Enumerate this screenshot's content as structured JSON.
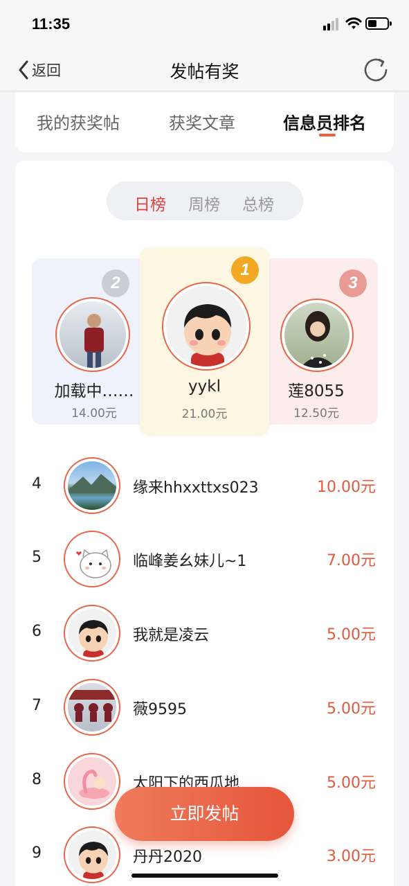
{
  "status_bar": {
    "time": "11:35"
  },
  "nav": {
    "back_label": "返回",
    "title": "发帖有奖"
  },
  "tabs": [
    {
      "label": "我的获奖帖",
      "active": false
    },
    {
      "label": "获奖文章",
      "active": false
    },
    {
      "label": "信息员排名",
      "active": true
    }
  ],
  "period_tabs": [
    {
      "label": "日榜",
      "active": true
    },
    {
      "label": "周榜",
      "active": false
    },
    {
      "label": "总榜",
      "active": false
    }
  ],
  "podium": {
    "first": {
      "rank": "1",
      "name": "yykl",
      "amount": "21.00元"
    },
    "second": {
      "rank": "2",
      "name": "加载中……",
      "amount": "14.00元"
    },
    "third": {
      "rank": "3",
      "name": "莲8055",
      "amount": "12.50元"
    }
  },
  "ranking_list": [
    {
      "rank": "4",
      "name": "缘来hhxxttxs023",
      "amount": "10.00元"
    },
    {
      "rank": "5",
      "name": "临峰姜幺妹儿~1",
      "amount": "7.00元"
    },
    {
      "rank": "6",
      "name": "我就是凌云",
      "amount": "5.00元"
    },
    {
      "rank": "7",
      "name": "薇9595",
      "amount": "5.00元"
    },
    {
      "rank": "8",
      "name": "太阳下的西瓜地",
      "amount": "5.00元"
    },
    {
      "rank": "9",
      "name": "丹丹2020",
      "amount": "3.00元"
    }
  ],
  "post_button": {
    "label": "立即发帖"
  },
  "colors": {
    "accent": "#e6553a",
    "active_period": "#e0413f",
    "gold": "#f2a823",
    "silver": "#c9cdd6",
    "bronze": "#e89a94"
  }
}
